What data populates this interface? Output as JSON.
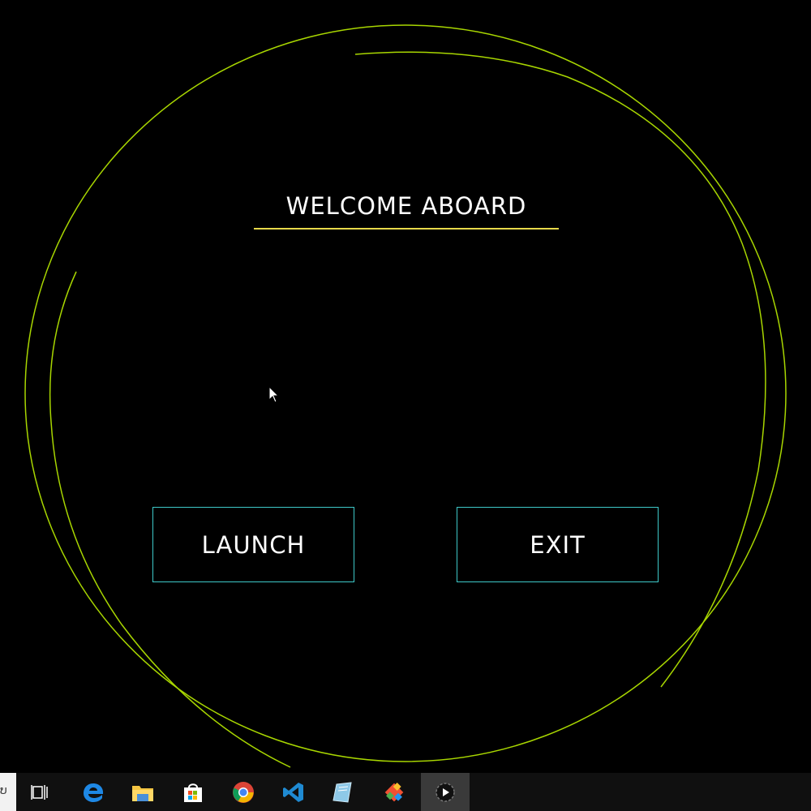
{
  "app": {
    "title": "WELCOME ABOARD",
    "accent_ring_color": "#a8d600",
    "underline_color": "#e6d84a",
    "button_border_color": "#3ec9c9",
    "buttons": {
      "launch_label": "LAUNCH",
      "exit_label": "EXIT"
    }
  },
  "taskbar": {
    "search_stub_text": "ບ",
    "items": [
      {
        "name": "task-view-icon"
      },
      {
        "name": "edge-icon"
      },
      {
        "name": "file-explorer-icon"
      },
      {
        "name": "microsoft-store-icon"
      },
      {
        "name": "chrome-icon"
      },
      {
        "name": "vscode-icon"
      },
      {
        "name": "notepad-icon"
      },
      {
        "name": "git-icon"
      },
      {
        "name": "media-player-icon",
        "active": true
      }
    ]
  }
}
